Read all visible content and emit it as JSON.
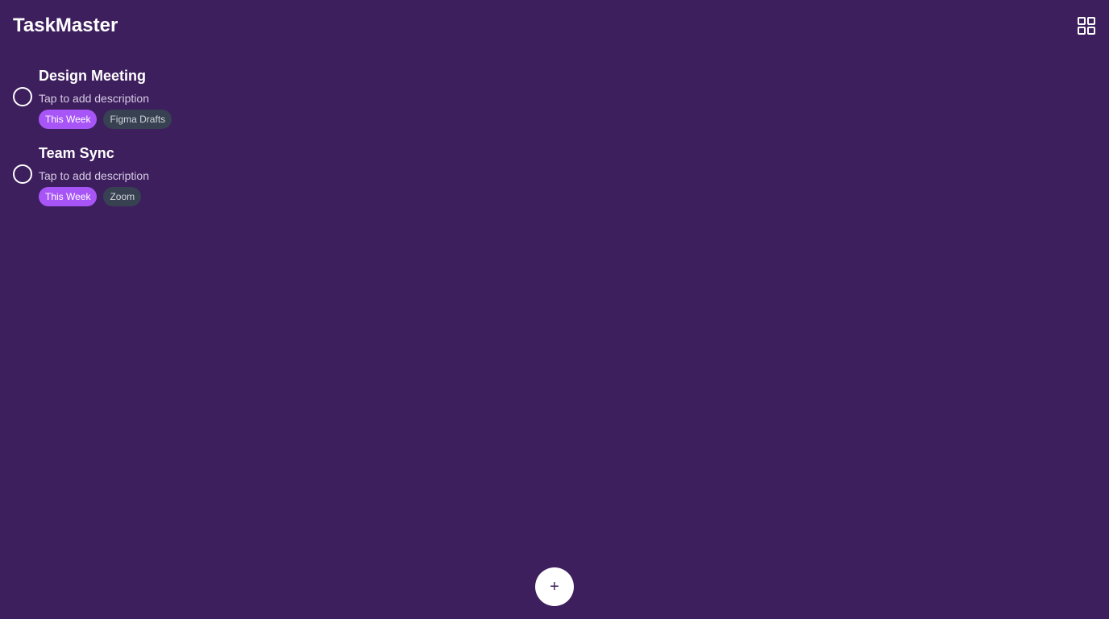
{
  "app": {
    "title": "TaskMaster",
    "layout_toggle_icon": "grid-icon",
    "background_color": "#3e1f5e"
  },
  "tasks": [
    {
      "title": "Design Meeting",
      "description_placeholder": "Tap to add description",
      "completed": false,
      "tags": [
        {
          "label": "This Week",
          "color": "#a855f7"
        },
        {
          "label": "Figma Drafts",
          "color": "#374151"
        }
      ]
    },
    {
      "title": "Team Sync",
      "description_placeholder": "Tap to add description",
      "completed": false,
      "tags": [
        {
          "label": "This Week",
          "color": "#a855f7"
        },
        {
          "label": "Zoom",
          "color": "#374151"
        }
      ]
    }
  ],
  "fab": {
    "label": "+",
    "icon": "plus-icon"
  }
}
